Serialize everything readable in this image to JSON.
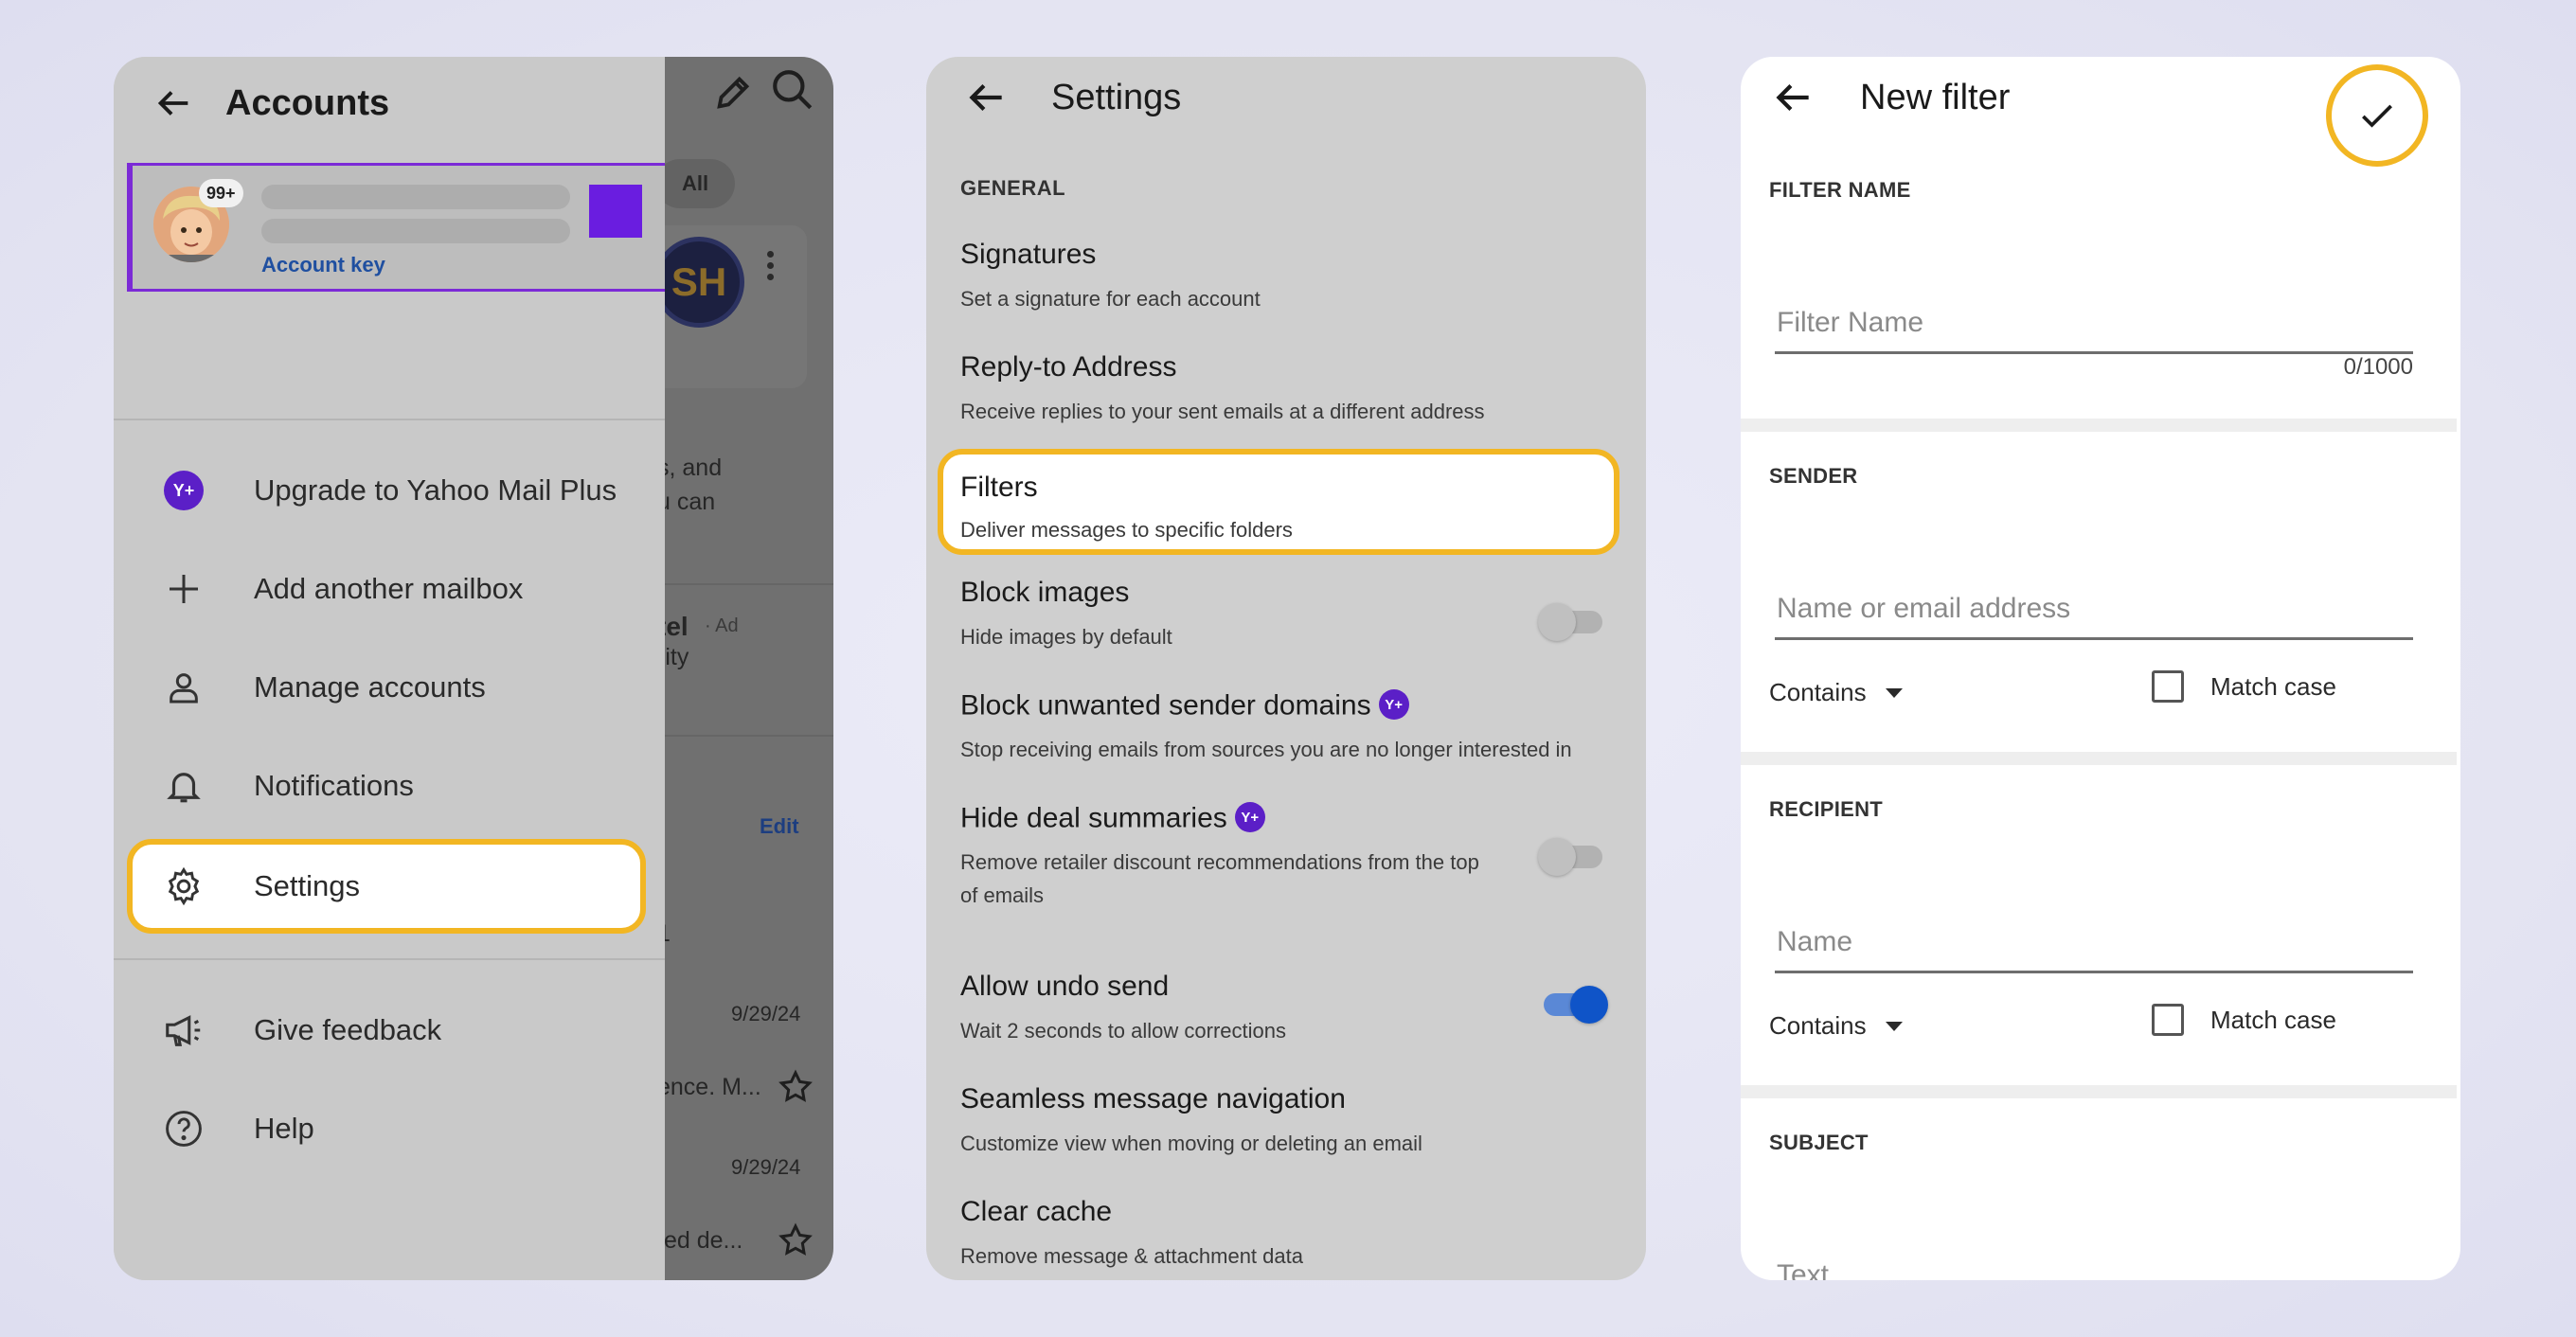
{
  "colors": {
    "highlight": "#f2b623",
    "accent_purple": "#6a1de0",
    "toggle_on": "#0f54c8"
  },
  "accounts_screen": {
    "title": "Accounts",
    "account": {
      "badge": "99+",
      "key_label": "Account key"
    },
    "behind": {
      "filter_pill": "All",
      "avatar_initials": "SH",
      "snippet_line1": "s, and",
      "snippet_line2": "u can",
      "ad_title": "tel",
      "ad_tag": "· Ad",
      "ad_line2": "rity",
      "edit_link": "Edit",
      "num": "1",
      "date1": "9/29/24",
      "preview1": "ence. M...",
      "date2": "9/29/24",
      "preview2": "ted de..."
    },
    "menu": [
      {
        "label": "Upgrade to Yahoo Mail Plus",
        "icon": "yahoo-plus-icon"
      },
      {
        "label": "Add another mailbox",
        "icon": "plus-icon"
      },
      {
        "label": "Manage accounts",
        "icon": "person-icon"
      },
      {
        "label": "Notifications",
        "icon": "bell-icon"
      },
      {
        "label": "Settings",
        "icon": "gear-icon"
      },
      {
        "label": "Give feedback",
        "icon": "megaphone-icon"
      },
      {
        "label": "Help",
        "icon": "help-icon"
      }
    ],
    "yplus_text": "Y+"
  },
  "settings_screen": {
    "title": "Settings",
    "section": "GENERAL",
    "rows": [
      {
        "title": "Signatures",
        "subtitle": "Set a signature for each account"
      },
      {
        "title": "Reply-to Address",
        "subtitle": "Receive replies to your sent emails at a different address"
      },
      {
        "title": "Filters",
        "subtitle": "Deliver messages to specific folders"
      },
      {
        "title": "Block images",
        "subtitle": "Hide images by default",
        "toggle": "off"
      },
      {
        "title": "Block unwanted sender domains",
        "subtitle": "Stop receiving emails from sources you are no longer interested in"
      },
      {
        "title": "Hide deal summaries",
        "subtitle": "Remove retailer discount recommendations from the top of emails",
        "toggle": "off"
      },
      {
        "title": "Allow undo send",
        "subtitle": "Wait 2 seconds to allow corrections",
        "toggle": "on"
      },
      {
        "title": "Seamless message navigation",
        "subtitle": "Customize view when moving or deleting an email"
      },
      {
        "title": "Clear cache",
        "subtitle": "Remove message & attachment data"
      }
    ],
    "plus_badge": "Y+"
  },
  "filter_screen": {
    "title": "New filter",
    "filter_name": {
      "label": "FILTER NAME",
      "placeholder": "Filter Name",
      "value": "",
      "counter": "0/1000"
    },
    "sender": {
      "label": "SENDER",
      "placeholder": "Name or email address",
      "value": "",
      "match_type": "Contains",
      "match_case_label": "Match case"
    },
    "recipient": {
      "label": "RECIPIENT",
      "placeholder": "Name",
      "value": "",
      "match_type": "Contains",
      "match_case_label": "Match case"
    },
    "subject": {
      "label": "SUBJECT",
      "placeholder": "Text",
      "value": ""
    }
  }
}
